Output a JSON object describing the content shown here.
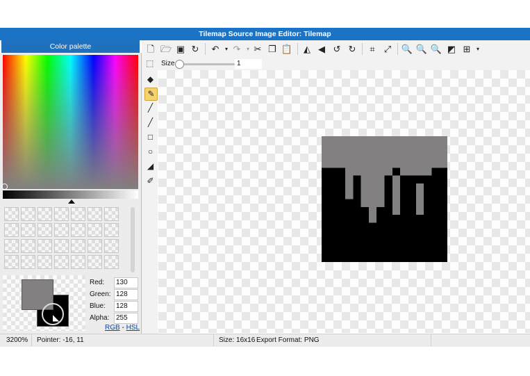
{
  "window": {
    "title": "Tilemap Source Image Editor: Tilemap"
  },
  "palette": {
    "header": "Color palette",
    "current_color": {
      "red": "130",
      "green": "128",
      "blue": "128",
      "alpha": "255"
    },
    "labels": {
      "red": "Red:",
      "green": "Green:",
      "blue": "Blue:",
      "alpha": "Alpha:"
    },
    "mode_links": {
      "rgb": "RGB",
      "separator": "-",
      "hsl": "HSL"
    },
    "primary_color": "#828080",
    "secondary_color": "#000000"
  },
  "toolbar": {
    "icons": [
      "new-file-icon",
      "open-folder-icon",
      "save-icon",
      "save-as-icon",
      "undo-icon",
      "redo-icon",
      "cut-icon",
      "copy-icon",
      "paste-icon",
      "flip-horizontal-icon",
      "flip-vertical-icon",
      "rotate-left-icon",
      "rotate-right-icon",
      "crop-icon",
      "resize-icon",
      "zoom-in-icon",
      "zoom-out-icon",
      "zoom-reset-icon",
      "toggle-background-icon",
      "grid-icon"
    ]
  },
  "options": {
    "size_label": "Size",
    "size_value": "1"
  },
  "tools": [
    "selection",
    "eraser",
    "pencil",
    "brush",
    "line",
    "rectangle",
    "ellipse",
    "fill",
    "eyedropper"
  ],
  "active_tool": "pencil",
  "image": {
    "width": 16,
    "height": 16,
    "colors": {
      "0": "#000000",
      "1": "#828080"
    },
    "rows": [
      "1111111111111111",
      "1111111111111111",
      "1111111111111111",
      "1111111111111111",
      "0001111110111100",
      "0001011101000000",
      "0001011101001000",
      "0001011101001000",
      "0000011101001000",
      "0000001001001000",
      "0000001000000000",
      "0000000000000000",
      "0000000000000000",
      "0000000000000000",
      "0000000000000000",
      "0000000000000000"
    ]
  },
  "statusbar": {
    "zoom": "3200%",
    "pointer": "Pointer: -16, 11",
    "size": "Size: 16x16",
    "export": "Export Format: PNG"
  }
}
